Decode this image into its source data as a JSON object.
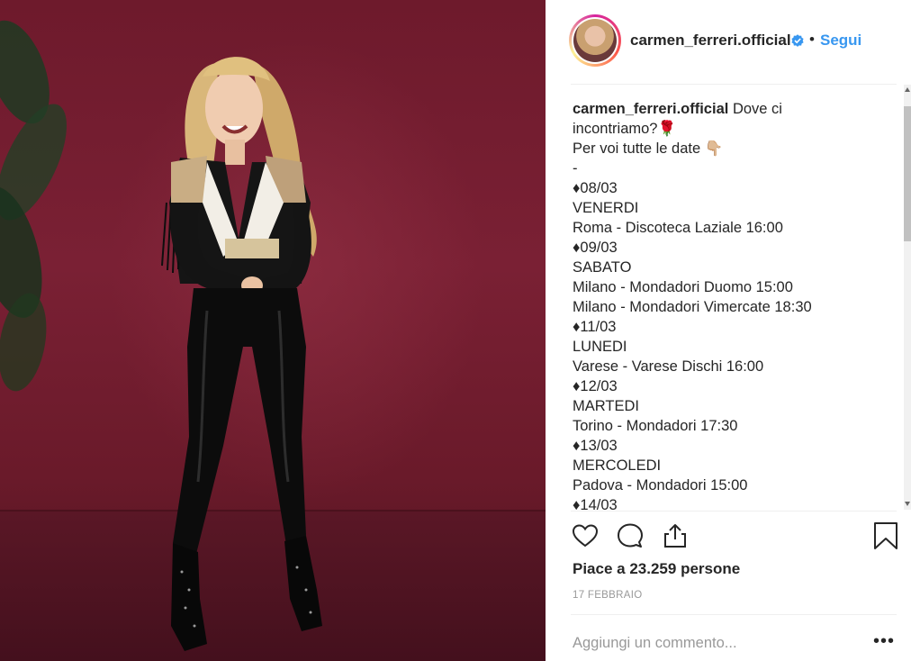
{
  "post": {
    "username": "carmen_ferreri.official",
    "verified": true,
    "separator": "•",
    "follow_label": "Segui",
    "caption_lines": [
      "Dove ci",
      "incontriamo?🌹",
      "Per voi tutte le date 👇🏼",
      "-",
      "♦08/03",
      "VENERDI",
      "Roma - Discoteca Laziale 16:00",
      "♦09/03",
      "SABATO",
      "Milano - Mondadori Duomo 15:00",
      "Milano - Mondadori Vimercate 18:30",
      "♦11/03",
      "LUNEDI",
      "Varese - Varese Dischi 16:00",
      "♦12/03",
      "MARTEDI",
      "Torino - Mondadori 17:30",
      "♦13/03",
      "MERCOLEDI",
      "Padova - Mondadori 15:00",
      "♦14/03"
    ],
    "likes_prefix": "Piace a",
    "likes_count": "23.259",
    "likes_suffix": "persone",
    "date": "17 FEBBRAIO",
    "comment_placeholder": "Aggiungi un commento...",
    "more_label": "•••"
  },
  "icons": {
    "like": "heart-outline-icon",
    "comment": "speech-bubble-icon",
    "share": "share-upload-icon",
    "save": "bookmark-icon",
    "verified": "verified-badge-icon"
  },
  "colors": {
    "accent": "#3897f0",
    "text": "#262626",
    "muted": "#999999",
    "divider": "#efefef",
    "photo_wall": "#7a2034"
  }
}
